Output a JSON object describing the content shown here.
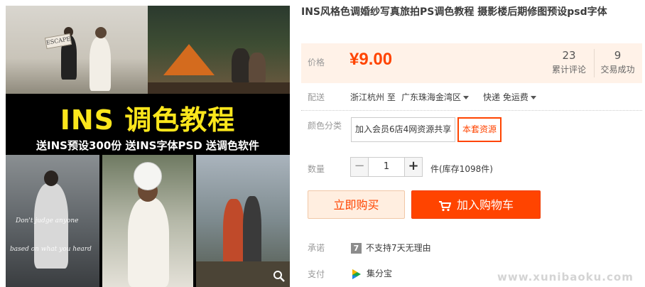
{
  "gallery": {
    "banner_title": "INS 调色教程",
    "banner_sub": "送INS预设300份  送INS字体PSD  送调色软件",
    "sign_text": "ESCAPE",
    "script_text_1": "Don't judge anyone",
    "script_text_2": "based on what you heard",
    "zoom_icon": "magnifier-icon"
  },
  "product": {
    "title": "INS风格色调婚纱写真旅拍PS调色教程 摄影楼后期修图预设psd字体"
  },
  "price": {
    "label": "价格",
    "value": "¥9.00",
    "color": "#ff4400"
  },
  "stats": {
    "reviews_count": "23",
    "reviews_label": "累计评论",
    "sales_count": "9",
    "sales_label": "交易成功"
  },
  "delivery": {
    "label": "配送",
    "from": "浙江杭州 至",
    "to": "广东珠海金湾区",
    "method": "快递 免运费"
  },
  "sku": {
    "label": "颜色分类",
    "options": [
      "加入会员6店4网资源共享",
      "本套资源"
    ],
    "selected": "本套资源"
  },
  "quantity": {
    "label": "数量",
    "minus": "−",
    "value": "1",
    "plus": "+",
    "stock": "件(库存1098件)"
  },
  "actions": {
    "buy_now": "立即购买",
    "add_to_cart": "加入购物车"
  },
  "promise": {
    "label": "承诺",
    "badge": "7",
    "text": "不支持7天无理由"
  },
  "payment": {
    "label": "支付",
    "text": "集分宝"
  },
  "watermark": "www.xunibaoku.com"
}
